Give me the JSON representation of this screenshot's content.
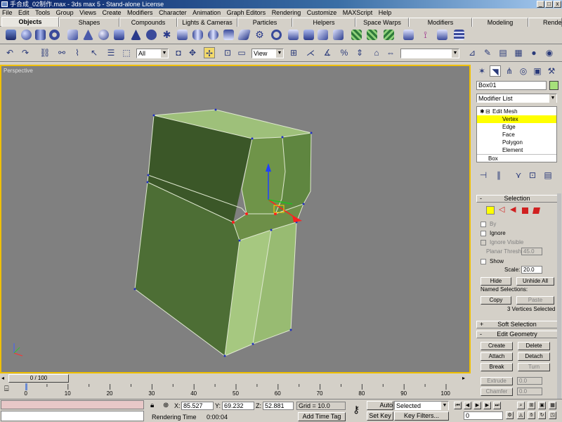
{
  "window": {
    "title": "手合成_02制作.max - 3ds max 5 - Stand-alone License",
    "min": "_",
    "max": "□",
    "close": "x"
  },
  "menu": [
    "File",
    "Edit",
    "Tools",
    "Group",
    "Views",
    "Create",
    "Modifiers",
    "Character",
    "Animation",
    "Graph Editors",
    "Rendering",
    "Customize",
    "MAXScript",
    "Help"
  ],
  "tabs": [
    "Objects",
    "Shapes",
    "Compounds",
    "Lights & Cameras",
    "Particles",
    "Helpers",
    "Space Warps",
    "Modifiers",
    "Modeling",
    "Rendering"
  ],
  "toolbar": {
    "selection_filter": "All",
    "ref_coord": "View",
    "named_selection": ""
  },
  "viewport": {
    "label": "Perspective"
  },
  "panel": {
    "object_name": "Box01",
    "modifier_list": "Modifier List",
    "stack": [
      "Edit Mesh",
      "Vertex",
      "Edge",
      "Face",
      "Polygon",
      "Element",
      "Box"
    ],
    "selection_title": "Selection",
    "by_label": "By",
    "ignore_backfacing": "Ignore",
    "ignore_visible": "Ignore Visible",
    "planar_thresh_label": "Planar Thresh:",
    "planar_thresh": "45.0",
    "show_label": "Show",
    "scale_label": "Scale:",
    "scale": "20.0",
    "hide": "Hide",
    "unhide_all": "Unhide All",
    "named_selections": "Named Selections:",
    "copy": "Copy",
    "paste": "Paste",
    "status": "3 Vertices Selected",
    "soft_selection": "Soft Selection",
    "edit_geometry": "Edit Geometry",
    "create": "Create",
    "delete": "Delete",
    "attach": "Attach",
    "detach": "Detach",
    "break": "Break",
    "turn": "Turn",
    "extrude": "Extrude",
    "extrude_val": "0.0",
    "chamfer": "Chamfer",
    "chamfer_val": "0.0",
    "plus": "+",
    "minus": "-"
  },
  "timeline": {
    "frame": "0 / 100",
    "ticks": [
      "0",
      "10",
      "20",
      "30",
      "40",
      "50",
      "60",
      "70",
      "80",
      "90",
      "100"
    ],
    "current_frame": 0,
    "frame_range": [
      0,
      100
    ]
  },
  "status": {
    "x_label": "X:",
    "x": "85.527",
    "y_label": "Y:",
    "y": "69.232",
    "z_label": "Z:",
    "z": "52.881",
    "grid": "Grid = 10.0",
    "render_time_label": "Rendering Time",
    "render_time": "0:00:04",
    "add_time_tag": "Add Time Tag",
    "auto_key": "Auto Key",
    "set_key": "Set Key",
    "selected": "Selected",
    "key_filters": "Key Filters...",
    "frame_field": "0"
  }
}
